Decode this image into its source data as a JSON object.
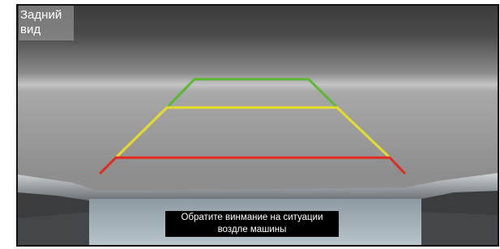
{
  "view_label": {
    "line1": "Задний",
    "line2": "вид"
  },
  "warning": {
    "line1": "Обратите винмание на ситуации",
    "line2": "воздле машины"
  },
  "guide_colors": {
    "far": "#5cb82e",
    "mid": "#e6dc2a",
    "near": "#e02a22"
  }
}
